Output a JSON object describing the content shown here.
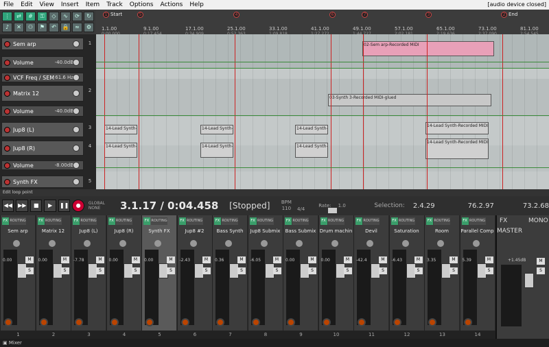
{
  "menu": [
    "File",
    "Edit",
    "View",
    "Insert",
    "Item",
    "Track",
    "Options",
    "Actions",
    "Help"
  ],
  "audio_status": "[audio device closed]",
  "markers": [
    {
      "num": "1",
      "label": "Start"
    },
    {
      "num": "5",
      "label": ""
    },
    {
      "num": "4",
      "label": ""
    },
    {
      "num": "6",
      "label": ""
    },
    {
      "num": "7",
      "label": ""
    },
    {
      "num": "3",
      "label": ""
    },
    {
      "num": "2",
      "label": "End"
    }
  ],
  "ruler_ticks": [
    {
      "bar": "1.1.00",
      "time": "0:00.000"
    },
    {
      "bar": "9.1.00",
      "time": "0:17.454"
    },
    {
      "bar": "17.1.00",
      "time": "0:34.909"
    },
    {
      "bar": "25.1.00",
      "time": "0:52.363"
    },
    {
      "bar": "33.1.00",
      "time": "1:09.818"
    },
    {
      "bar": "41.1.00",
      "time": "1:27.272"
    },
    {
      "bar": "49.1.00",
      "time": "1:44.727"
    },
    {
      "bar": "57.1.00",
      "time": "2:02.181"
    },
    {
      "bar": "65.1.00",
      "time": "2:19.636"
    },
    {
      "bar": "73.1.00",
      "time": "2:37.090"
    },
    {
      "bar": "81.1.00",
      "time": "2:54.545"
    }
  ],
  "tracks": [
    {
      "name": "Sem arp",
      "value": "",
      "num": "1",
      "env": false
    },
    {
      "name": "Volume",
      "value": "-40.0dB",
      "num": "",
      "env": true
    },
    {
      "name": "VCF Freq / SEM V",
      "value": "61.6 Hz",
      "num": "",
      "env": true
    },
    {
      "name": "Matrix 12",
      "value": "",
      "num": "2",
      "env": false
    },
    {
      "name": "Volume",
      "value": "-40.0dB",
      "num": "",
      "env": true
    },
    {
      "name": "Jup8 (L)",
      "value": "",
      "num": "3",
      "env": false
    },
    {
      "name": "Jup8 (R)",
      "value": "",
      "num": "4",
      "env": false
    },
    {
      "name": "Volume",
      "value": "-8.00dB",
      "num": "",
      "env": true
    },
    {
      "name": "Synth FX",
      "value": "",
      "num": "5",
      "env": false
    }
  ],
  "items": [
    {
      "label": "02-Sem arp-Recorded MIDI",
      "color": "#e8a0b8"
    },
    {
      "label": "03-Synth 3-Recorded MIDI-glued",
      "color": "#c8c8c8"
    },
    {
      "label": "14-Lead Synth-",
      "color": "#d0d0d0"
    },
    {
      "label": "14-Lead Synth-",
      "color": "#d0d0d0"
    },
    {
      "label": "14-Lead Synth-",
      "color": "#d0d0d0"
    },
    {
      "label": "14-Lead Synth-Recorded MIDI-...",
      "color": "#d0d0d0"
    },
    {
      "label": "14-Lead Synth-",
      "color": "#d0d0d0"
    },
    {
      "label": "14-Lead Synth-",
      "color": "#d0d0d0"
    },
    {
      "label": "14-Lead Synth-",
      "color": "#d0d0d0"
    },
    {
      "label": "14-Lead Synth-Recorded MIDI-...",
      "color": "#d0d0d0"
    }
  ],
  "status_line": "Edit loop point",
  "transport": {
    "time": "3.1.17 / 0:04.458",
    "state": "[Stopped]",
    "bpm_label": "BPM",
    "bpm": "110",
    "sig": "4/4",
    "rate_label": "Rate:",
    "rate": "1.0",
    "selection_label": "Selection:",
    "sel_start": "2.4.29",
    "sel_end": "76.2.97",
    "sel_len": "73.2.68",
    "global_label": "GLOBAL",
    "global_mode": "NONE"
  },
  "mixer": [
    {
      "name": "Sem arp",
      "peak": "0.00",
      "num": "1"
    },
    {
      "name": "Matrix 12",
      "peak": "0.00",
      "num": "2"
    },
    {
      "name": "Jup8 (L)",
      "peak": "-7.78",
      "num": "3"
    },
    {
      "name": "Jup8 (R)",
      "peak": "0.00",
      "num": "4"
    },
    {
      "name": "Synth FX",
      "peak": "0.00",
      "num": "5"
    },
    {
      "name": "Jup8 #2",
      "peak": "-2.43",
      "num": "6"
    },
    {
      "name": "Bass Synth",
      "peak": "0.36",
      "num": "7"
    },
    {
      "name": "Jup8 Submix",
      "peak": "-6.05",
      "num": "8"
    },
    {
      "name": "Bass Submix",
      "peak": "0.00",
      "num": "9"
    },
    {
      "name": "Drum machin",
      "peak": "0.00",
      "num": "10"
    },
    {
      "name": "Devil",
      "peak": "-42.4",
      "num": "11"
    },
    {
      "name": "Saturation",
      "peak": "-6.43",
      "num": "12"
    },
    {
      "name": "Room",
      "peak": "3.35",
      "num": "13"
    },
    {
      "name": "Parallel Comp",
      "peak": "5.39",
      "num": "14"
    }
  ],
  "master": {
    "name": "MASTER",
    "peak": "+1.45dB",
    "mono": "MONO"
  },
  "footer": "Mixer",
  "fx_label": "FX",
  "routing_label": "ROUTING",
  "m_label": "M",
  "s_label": "S"
}
